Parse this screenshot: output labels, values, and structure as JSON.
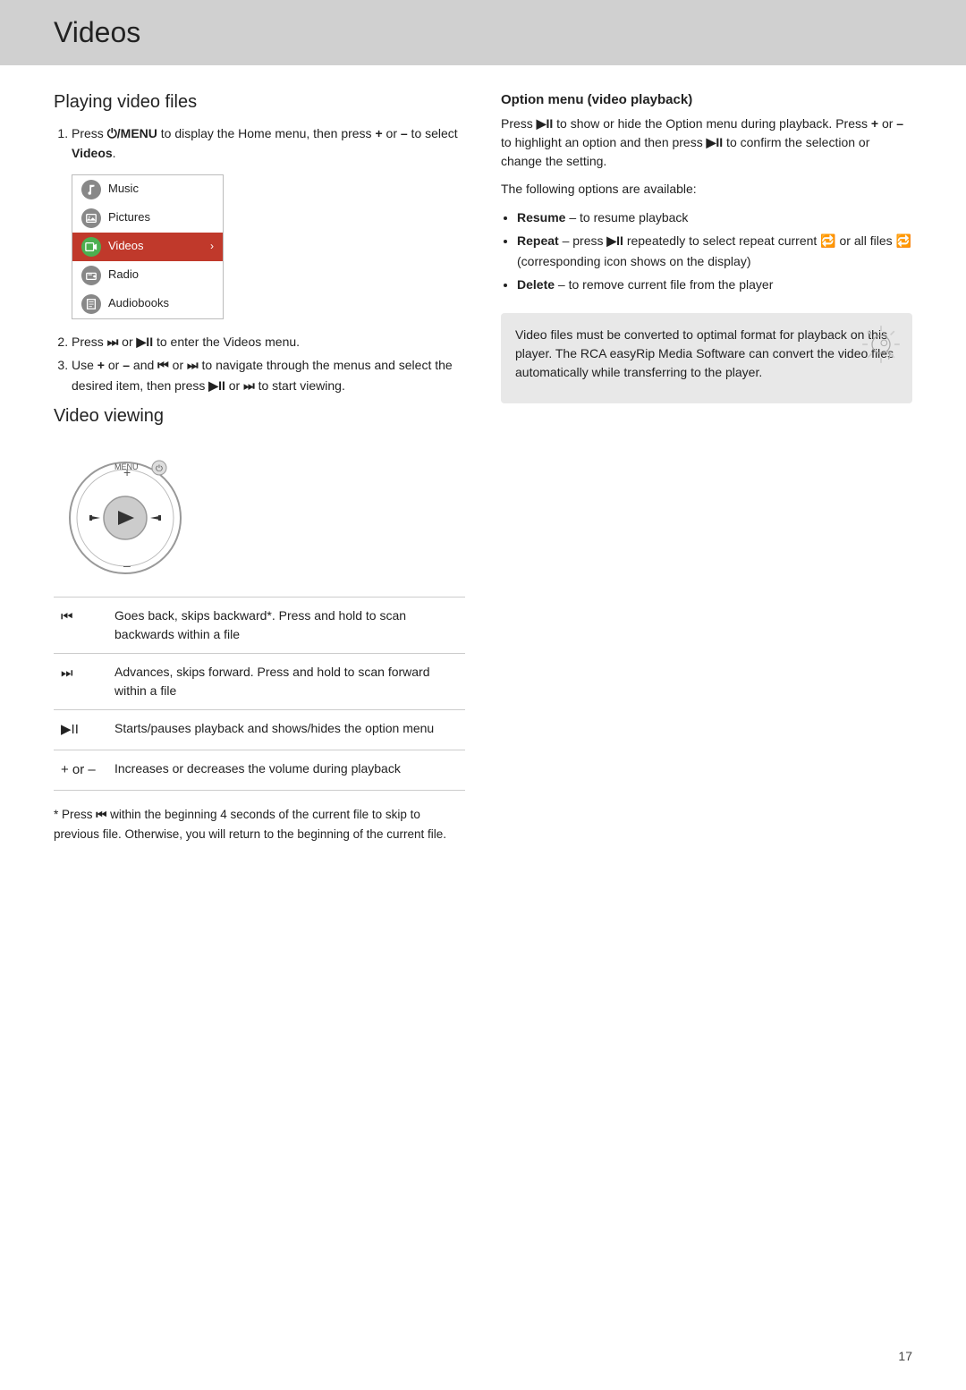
{
  "page": {
    "title": "Videos",
    "number": "17"
  },
  "left_column": {
    "section1_title": "Playing video files",
    "step1": "Press ⏻/MENU to display the Home menu, then press + or – to select Videos.",
    "menu_items": [
      {
        "label": "Music",
        "selected": false
      },
      {
        "label": "Pictures",
        "selected": false
      },
      {
        "label": "Videos",
        "selected": true,
        "arrow": "›"
      },
      {
        "label": "Radio",
        "selected": false
      },
      {
        "label": "Audiobooks",
        "selected": false
      }
    ],
    "step2": "Press ⏩ or ▶II to enter the Videos menu.",
    "step3": "Use + or – and ⏮ or ⏩ to navigate through the menus and select the desired item, then press ▶II or ⏩ to start viewing.",
    "section2_title": "Video viewing",
    "controls_table": [
      {
        "symbol": "⏮",
        "description": "Goes back, skips backward*. Press and hold to scan backwards within a file"
      },
      {
        "symbol": "⏭",
        "description": "Advances, skips forward. Press and hold to scan forward within a file"
      },
      {
        "symbol": "▶II",
        "description": "Starts/pauses playback and shows/hides the option menu"
      },
      {
        "symbol": "+ or –",
        "description": "Increases or decreases the volume during playback"
      }
    ],
    "footnote": "* Press ⏮ within the beginning 4 seconds of the current file to skip to previous file. Otherwise, you will return to the beginning of the current file."
  },
  "right_column": {
    "option_menu_title": "Option menu (video playback)",
    "option_menu_desc1": "Press ▶II to show or hide the Option menu during playback. Press + or – to highlight an option and then press ▶II to confirm the selection or change the setting.",
    "option_menu_desc2": "The following options are available:",
    "options": [
      {
        "label": "Resume",
        "desc": "– to resume playback"
      },
      {
        "label": "Repeat",
        "desc": "– press ▶II repeatedly to select repeat current 🔁 or all files 🔁 (corresponding icon shows on the display)"
      },
      {
        "label": "Delete",
        "desc": "– to remove current file from the player"
      }
    ],
    "note_text": "Video files must be converted to optimal format for playback on this player. The RCA easyRip Media Software can convert the video files automatically while transferring to the player."
  }
}
